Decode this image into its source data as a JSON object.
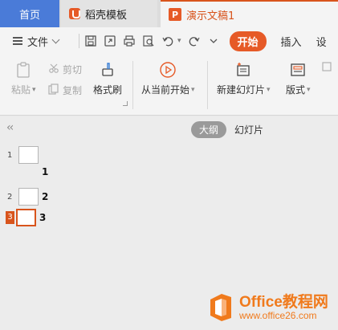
{
  "tabs": {
    "home": "首页",
    "template": "稻壳模板",
    "document": "演示文稿1"
  },
  "menubar": {
    "file": "文件",
    "tabs": [
      "开始",
      "插入",
      "设"
    ]
  },
  "ribbon": {
    "paste": "粘贴",
    "cut": "剪切",
    "copy": "复制",
    "format_painter": "格式刷",
    "play_from_current": "从当前开始",
    "new_slide": "新建幻灯片",
    "layout": "版式"
  },
  "outline": {
    "view_outline": "大纲",
    "view_slides": "幻灯片",
    "slides": [
      {
        "number": "1",
        "text": "1"
      },
      {
        "number": "2",
        "text": "2"
      },
      {
        "number": "3",
        "text": "3"
      }
    ]
  },
  "watermark": {
    "title": "Office教程网",
    "url": "www.office26.com"
  },
  "colors": {
    "accent": "#e65a27",
    "home_tab": "#4a7bd8"
  }
}
